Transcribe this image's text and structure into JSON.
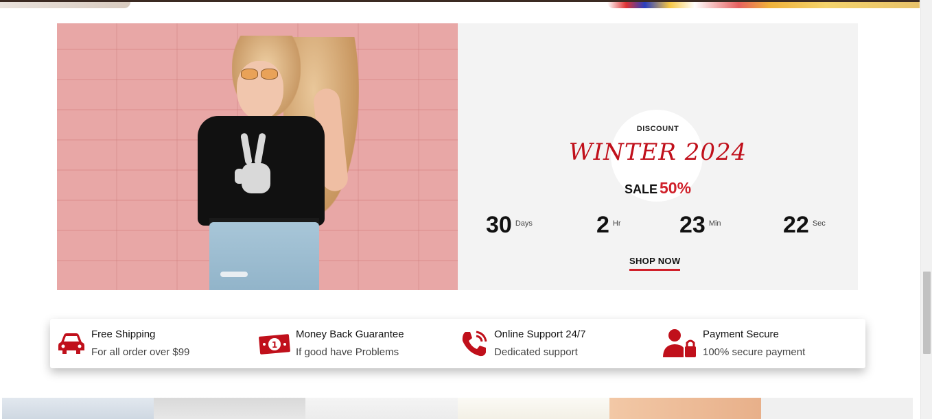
{
  "banner": {
    "discount_label": "DISCOUNT",
    "title": "WINTER 2024",
    "sale_label": "SALE",
    "sale_percent": "50%",
    "countdown": [
      {
        "value": "30",
        "unit": "Days"
      },
      {
        "value": "2",
        "unit": "Hr"
      },
      {
        "value": "23",
        "unit": "Min"
      },
      {
        "value": "22",
        "unit": "Sec"
      }
    ],
    "cta_label": "SHOP NOW",
    "accent_color": "#d0202a",
    "image_description_icon": "model-photo"
  },
  "features": [
    {
      "icon": "car-icon",
      "title": "Free Shipping",
      "subtitle": "For all order over $99"
    },
    {
      "icon": "money-icon",
      "title": "Money Back Guarantee",
      "subtitle": "If good have Problems"
    },
    {
      "icon": "phone-icon",
      "title": "Online Support 24/7",
      "subtitle": "Dedicated support"
    },
    {
      "icon": "user-lock-icon",
      "title": "Payment Secure",
      "subtitle": "100% secure payment"
    }
  ]
}
